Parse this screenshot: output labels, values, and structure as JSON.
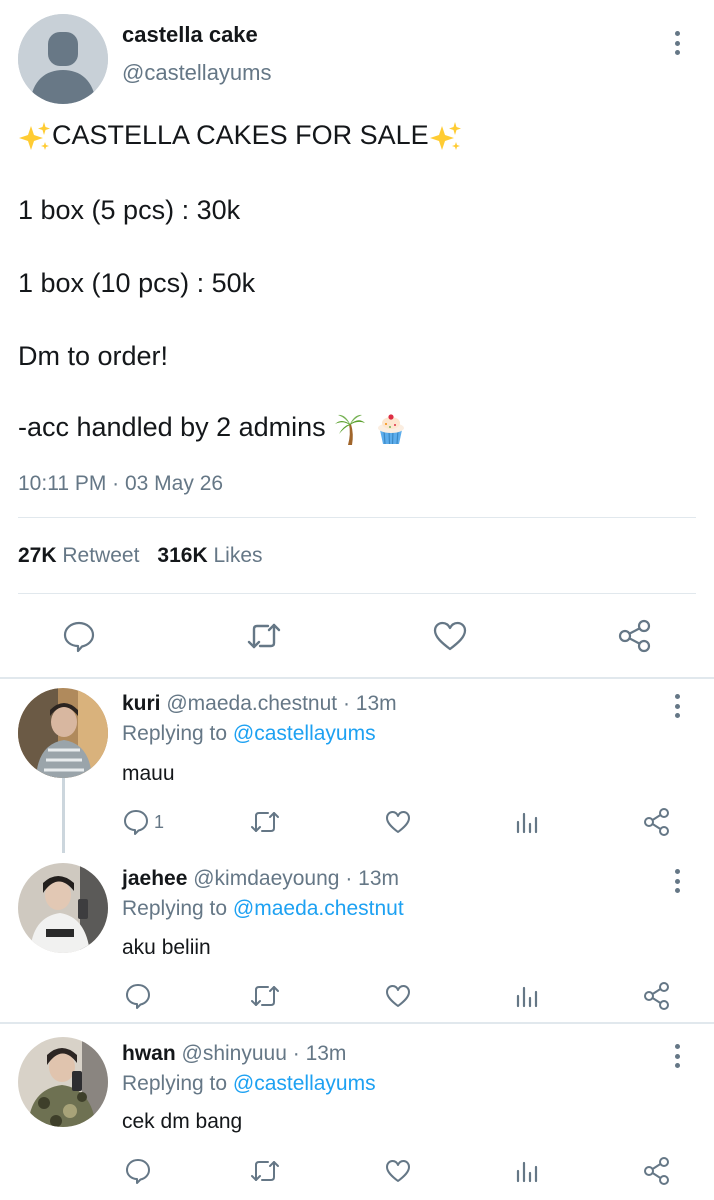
{
  "tweet": {
    "author_name": "castella cake",
    "author_handle": "@castellayums",
    "lines": [
      "CASTELLA CAKES FOR SALE",
      "1 box (5 pcs) : 30k",
      "1 box (10 pcs) : 50k",
      "Dm to order!",
      "-acc handled by 2 admins"
    ],
    "timestamp": "10:11 PM · 03 May 26",
    "retweet_count": "27K",
    "retweet_label": "Retweet",
    "like_count": "316K",
    "like_label": "Likes"
  },
  "replies": [
    {
      "name": "kuri",
      "handle": "@maeda.chestnut",
      "time": "· 13m",
      "replying_label": "Replying to",
      "replying_to": "@castellayums",
      "text": "mauu",
      "reply_count": "1"
    },
    {
      "name": "jaehee",
      "handle": "@kimdaeyoung",
      "time": "· 13m",
      "replying_label": "Replying to",
      "replying_to": "@maeda.chestnut",
      "text": "aku beliin"
    },
    {
      "name": "hwan",
      "handle": "@shinyuuu",
      "time": "· 13m",
      "replying_label": "Replying to",
      "replying_to": "@castellayums",
      "text": "cek dm bang"
    }
  ],
  "icons": {
    "more": "more-vertical-icon",
    "reply": "comment-icon",
    "retweet": "retweet-icon",
    "like": "heart-icon",
    "share": "share-icon",
    "analytics": "analytics-icon",
    "sparkles": "sparkles-icon",
    "palm": "palm-tree-icon",
    "cupcake": "cupcake-icon"
  },
  "colors": {
    "text": "#14171a",
    "secondary": "#657786",
    "link": "#1da1f2",
    "divider": "#e1e8ed"
  }
}
